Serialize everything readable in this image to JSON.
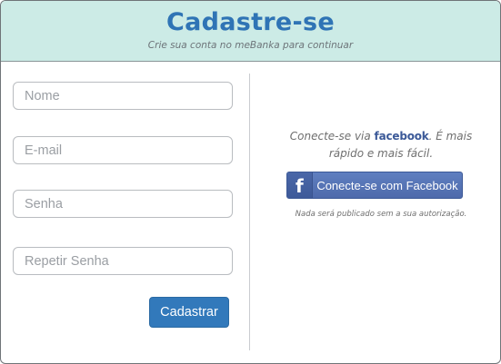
{
  "header": {
    "title": "Cadastre-se",
    "subtitle": "Crie sua conta no meBanka para continuar",
    "background": "#ccebe6",
    "title_color": "#2f74b5"
  },
  "form": {
    "nome_placeholder": "Nome",
    "email_placeholder": "E-mail",
    "senha_placeholder": "Senha",
    "repetir_senha_placeholder": "Repetir Senha",
    "submit_label": "Cadastrar",
    "submit_color": "#3279bb"
  },
  "social": {
    "connect_prefix": "Conecte-se via ",
    "connect_brand": "facebook",
    "connect_suffix": ". É mais rápido e mais fácil.",
    "facebook_button_label": "Conecte-se com Facebook",
    "facebook_icon_glyph": "f",
    "facebook_icon": "facebook-f-icon",
    "facebook_color": "#3b5998",
    "privacy_note": "Nada será publicado sem a sua autorização."
  }
}
